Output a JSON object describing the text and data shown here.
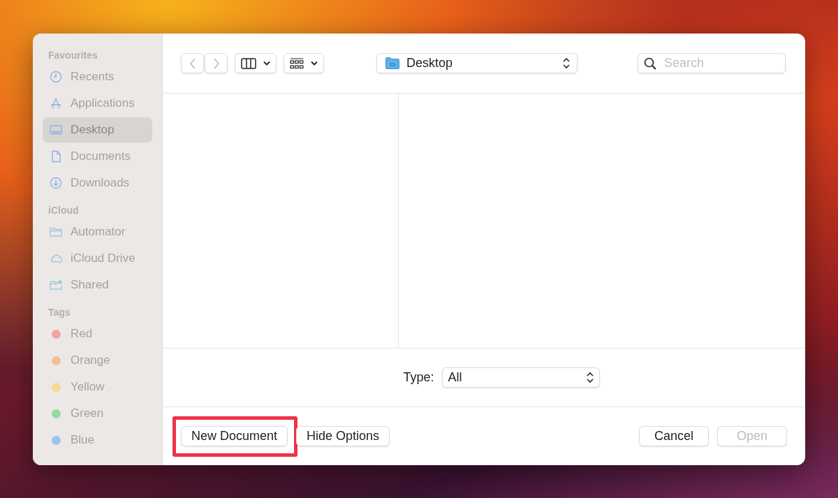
{
  "sidebar": {
    "sections": [
      {
        "title": "Favourites",
        "items": [
          {
            "label": "Recents",
            "kind": "recents",
            "selected": false
          },
          {
            "label": "Applications",
            "kind": "applications",
            "selected": false
          },
          {
            "label": "Desktop",
            "kind": "desktop",
            "selected": true
          },
          {
            "label": "Documents",
            "kind": "documents",
            "selected": false
          },
          {
            "label": "Downloads",
            "kind": "downloads",
            "selected": false
          }
        ]
      },
      {
        "title": "iCloud",
        "items": [
          {
            "label": "Automator",
            "kind": "folder",
            "selected": false
          },
          {
            "label": "iCloud Drive",
            "kind": "cloud",
            "selected": false
          },
          {
            "label": "Shared",
            "kind": "shared",
            "selected": false
          }
        ]
      },
      {
        "title": "Tags",
        "items": [
          {
            "label": "Red",
            "kind": "tag",
            "color": "#f4a3a3",
            "selected": false
          },
          {
            "label": "Orange",
            "kind": "tag",
            "color": "#f1c094",
            "selected": false
          },
          {
            "label": "Yellow",
            "kind": "tag",
            "color": "#f2dc8e",
            "selected": false
          },
          {
            "label": "Green",
            "kind": "tag",
            "color": "#9ad79e",
            "selected": false
          },
          {
            "label": "Blue",
            "kind": "tag",
            "color": "#9fc2f1",
            "selected": false
          }
        ]
      }
    ]
  },
  "toolbar": {
    "back_disabled": true,
    "forward_disabled": true,
    "location": "Desktop",
    "search": {
      "placeholder": "Search"
    }
  },
  "options": {
    "type_label": "Type:",
    "type_value": "All"
  },
  "buttons_left": [
    {
      "label": "New Document",
      "highlighted": true,
      "disabled": false
    },
    {
      "label": "Hide Options",
      "highlighted": false,
      "disabled": false
    }
  ],
  "buttons_right": [
    {
      "label": "Cancel",
      "highlighted": false,
      "disabled": false
    },
    {
      "label": "Open",
      "highlighted": false,
      "disabled": true
    }
  ]
}
